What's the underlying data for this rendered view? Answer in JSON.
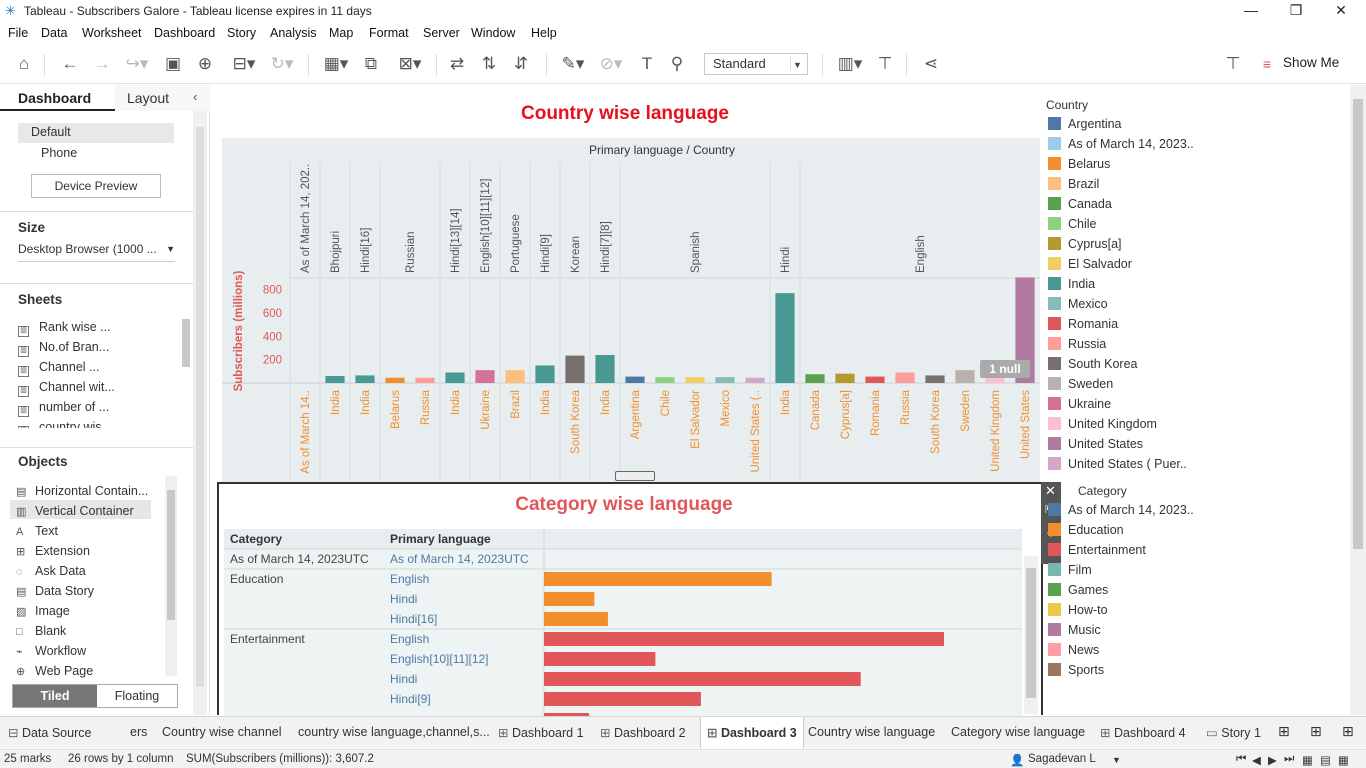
{
  "window": {
    "title": "Tableau - Subscribers Galore - Tableau license expires in 11 days",
    "controls": [
      "minimize",
      "restore",
      "close"
    ]
  },
  "menu": [
    "File",
    "Data",
    "Worksheet",
    "Dashboard",
    "Story",
    "Analysis",
    "Map",
    "Format",
    "Server",
    "Window",
    "Help"
  ],
  "toolbar": {
    "fit_select": "Standard",
    "show_me": "Show Me"
  },
  "left_panel": {
    "tabs": [
      "Dashboard",
      "Layout"
    ],
    "device": {
      "default": "Default",
      "phone": "Phone",
      "preview_button": "Device Preview"
    },
    "size": {
      "heading": "Size",
      "value": "Desktop Browser (1000 ..."
    },
    "sheets": {
      "heading": "Sheets",
      "items": [
        "Rank wise ...",
        "No.of Bran...",
        "Channel ...",
        "Channel wit...",
        "number of ...",
        "country wis..."
      ]
    },
    "objects": {
      "heading": "Objects",
      "items": [
        "Horizontal Contain...",
        "Vertical Container",
        "Text",
        "Extension",
        "Ask Data",
        "Data Story",
        "Image",
        "Blank",
        "Workflow",
        "Web Page"
      ],
      "icons": [
        "horizontal-container-icon",
        "vertical-container-icon",
        "text-icon",
        "extension-icon",
        "ask-data-icon",
        "data-story-icon",
        "image-icon",
        "blank-icon",
        "workflow-icon",
        "web-page-icon"
      ],
      "tiled": "Tiled",
      "floating": "Floating"
    }
  },
  "chart1": {
    "title": "Country wise language",
    "header": "Primary language / Country",
    "ylabel": "Subscribers (millions)",
    "yticks": [
      "800",
      "600",
      "400",
      "200"
    ],
    "null_badge": "1 null",
    "languages": [
      "As of March 14, 202..",
      "Bhojpuri",
      "Hindi[16]",
      "Russian",
      "Hindi[13][14]",
      "English[10][11][12]",
      "Portuguese",
      "Hindi[9]",
      "Korean",
      "Hindi[7][8]",
      "Spanish",
      "Hindi",
      "English"
    ]
  },
  "chart_data": [
    {
      "type": "bar",
      "title": "Country wise language",
      "ylabel": "Subscribers (millions)",
      "ylim": [
        0,
        900
      ],
      "categories": [
        "As of March 14..",
        "India",
        "India",
        "Belarus",
        "Russia",
        "India",
        "Ukraine",
        "Brazil",
        "India",
        "South Korea",
        "India",
        "Argentina",
        "Chile",
        "El Salvador",
        "Mexico",
        "United States (..",
        "India",
        "Canada",
        "Cyprus[a]",
        "Romania",
        "Russia",
        "South Korea",
        "Sweden",
        "United Kingdom",
        "United States"
      ],
      "values": [
        0,
        60,
        65,
        45,
        45,
        90,
        110,
        110,
        150,
        235,
        240,
        55,
        50,
        50,
        50,
        45,
        770,
        75,
        80,
        55,
        90,
        65,
        110,
        60,
        905
      ],
      "colors": [
        "#a0cbe8",
        "#499894",
        "#499894",
        "#f28e2b",
        "#ff9d9a",
        "#499894",
        "#d37295",
        "#ffbe7d",
        "#499894",
        "#79706e",
        "#499894",
        "#4e79a7",
        "#8cd17d",
        "#f1ce63",
        "#86bcb6",
        "#d4a6c8",
        "#499894",
        "#59a14f",
        "#b6992d",
        "#e15759",
        "#ff9d9a",
        "#79706e",
        "#bab0ac",
        "#fabfd2",
        "#b07aa1"
      ]
    },
    {
      "type": "bar",
      "title": "Category wise language",
      "categories": [
        "Education / English",
        "Education / Hindi",
        "Education / Hindi[16]",
        "Entertainment / English",
        "Entertainment / English[10][11][12]",
        "Entertainment / Hindi",
        "Entertainment / Hindi[9]"
      ],
      "values": [
        235,
        52,
        66,
        413,
        115,
        327,
        162
      ],
      "colors": [
        "#f28e2b",
        "#f28e2b",
        "#f28e2b",
        "#e15759",
        "#e15759",
        "#e15759",
        "#e15759"
      ]
    }
  ],
  "chart2": {
    "title": "Category wise language",
    "col_headers": [
      "Category",
      "Primary language"
    ],
    "rows": [
      {
        "category": "As of March 14, 2023UTC",
        "language": "As of March 14, 2023UTC"
      },
      {
        "category": "Education",
        "language": "English"
      },
      {
        "category": "",
        "language": "Hindi"
      },
      {
        "category": "",
        "language": "Hindi[16]"
      },
      {
        "category": "Entertainment",
        "language": "English"
      },
      {
        "category": "",
        "language": "English[10][11][12]"
      },
      {
        "category": "",
        "language": "Hindi"
      },
      {
        "category": "",
        "language": "Hindi[9]"
      }
    ]
  },
  "legend_country": {
    "heading": "Country",
    "items": [
      {
        "label": "Argentina",
        "color": "#4e79a7"
      },
      {
        "label": "As of March 14, 2023..",
        "color": "#a0cbe8"
      },
      {
        "label": "Belarus",
        "color": "#f28e2b"
      },
      {
        "label": "Brazil",
        "color": "#ffbe7d"
      },
      {
        "label": "Canada",
        "color": "#59a14f"
      },
      {
        "label": "Chile",
        "color": "#8cd17d"
      },
      {
        "label": "Cyprus[a]",
        "color": "#b6992d"
      },
      {
        "label": "El Salvador",
        "color": "#f1ce63"
      },
      {
        "label": "India",
        "color": "#499894"
      },
      {
        "label": "Mexico",
        "color": "#86bcb6"
      },
      {
        "label": "Romania",
        "color": "#e15759"
      },
      {
        "label": "Russia",
        "color": "#ff9d9a"
      },
      {
        "label": "South Korea",
        "color": "#79706e"
      },
      {
        "label": "Sweden",
        "color": "#bab0ac"
      },
      {
        "label": "Ukraine",
        "color": "#d37295"
      },
      {
        "label": "United Kingdom",
        "color": "#fabfd2"
      },
      {
        "label": "United States",
        "color": "#b07aa1"
      },
      {
        "label": "United States ( Puer..",
        "color": "#d4a6c8"
      }
    ]
  },
  "legend_category": {
    "heading": "Category",
    "items": [
      {
        "label": "As of March 14, 2023..",
        "color": "#4e79a7"
      },
      {
        "label": "Education",
        "color": "#f28e2b"
      },
      {
        "label": "Entertainment",
        "color": "#e15759"
      },
      {
        "label": "Film",
        "color": "#76b7b2"
      },
      {
        "label": "Games",
        "color": "#59a14f"
      },
      {
        "label": "How-to",
        "color": "#edc948"
      },
      {
        "label": "Music",
        "color": "#b07aa1"
      },
      {
        "label": "News",
        "color": "#ff9da7"
      },
      {
        "label": "Sports",
        "color": "#9c755f"
      }
    ]
  },
  "bottom_tabs": [
    {
      "label": "Data Source",
      "icon": "database-icon"
    },
    {
      "label": "ers",
      "icon": ""
    },
    {
      "label": "Country wise channel",
      "icon": ""
    },
    {
      "label": "country wise language,channel,s...",
      "icon": ""
    },
    {
      "label": "Dashboard 1",
      "icon": "dashboard-icon"
    },
    {
      "label": "Dashboard 2",
      "icon": "dashboard-icon"
    },
    {
      "label": "Dashboard 3",
      "icon": "dashboard-icon"
    },
    {
      "label": "Country wise language",
      "icon": ""
    },
    {
      "label": "Category wise language",
      "icon": ""
    },
    {
      "label": "Dashboard 4",
      "icon": "dashboard-icon"
    },
    {
      "label": "Story 1",
      "icon": "story-icon"
    }
  ],
  "status": {
    "marks": "25 marks",
    "rows": "26 rows by 1 column",
    "sum": "SUM(Subscribers (millions)): 3,607.2",
    "user": "Sagadevan L"
  }
}
